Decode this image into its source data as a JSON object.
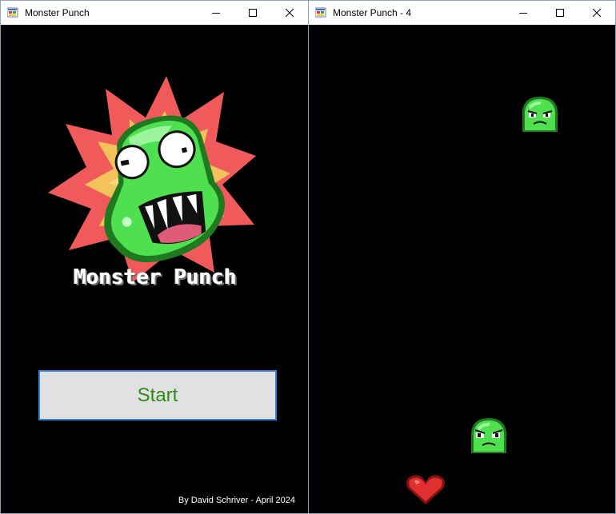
{
  "windows": {
    "left": {
      "title": "Monster Punch"
    },
    "right": {
      "title": "Monster Punch - 4"
    }
  },
  "menu": {
    "logo_text": "Monster Punch",
    "start_label": "Start",
    "credit": "By David Schriver - April 2024"
  },
  "game": {
    "entities": [
      "monster-1",
      "monster-2",
      "heart-player"
    ]
  },
  "colors": {
    "monster_green": "#4fe04f",
    "start_text": "#2d8a1c",
    "button_border": "#2f86d6",
    "burst_red": "#f05a5a",
    "heart_red": "#e03030"
  }
}
